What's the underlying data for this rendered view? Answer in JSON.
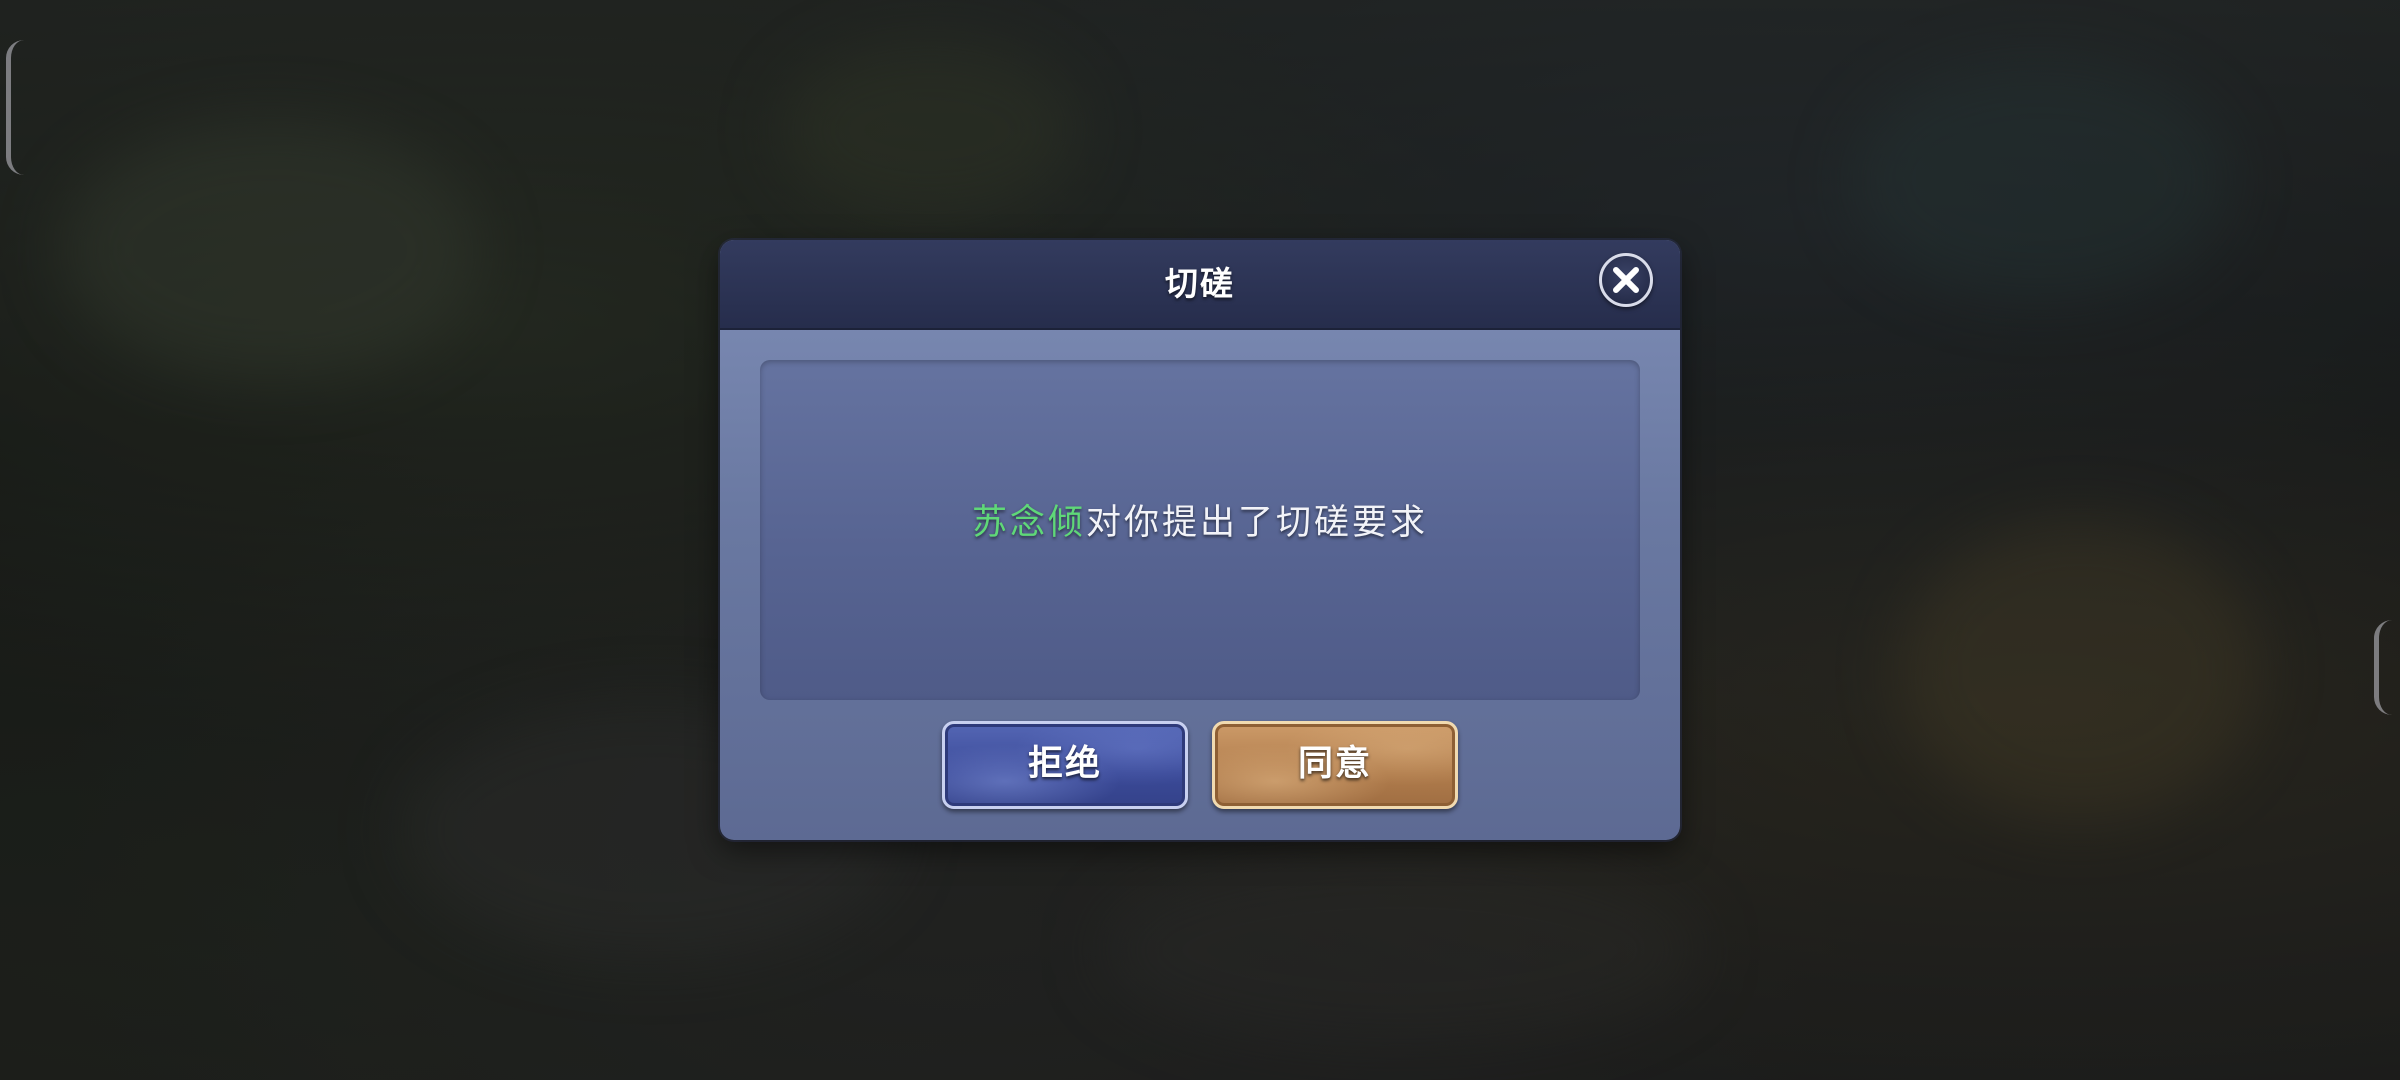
{
  "dialog": {
    "title": "切磋",
    "message": {
      "player_name": "苏念倾",
      "text": "对你提出了切磋要求"
    },
    "buttons": {
      "reject_label": "拒绝",
      "agree_label": "同意"
    },
    "icons": {
      "close": "close-icon"
    }
  },
  "colors": {
    "player_name": "#5fd878",
    "header": "#2b3253",
    "body": "#6f7ea8",
    "reject_button": "#3f4e9c",
    "agree_button": "#b98452"
  }
}
